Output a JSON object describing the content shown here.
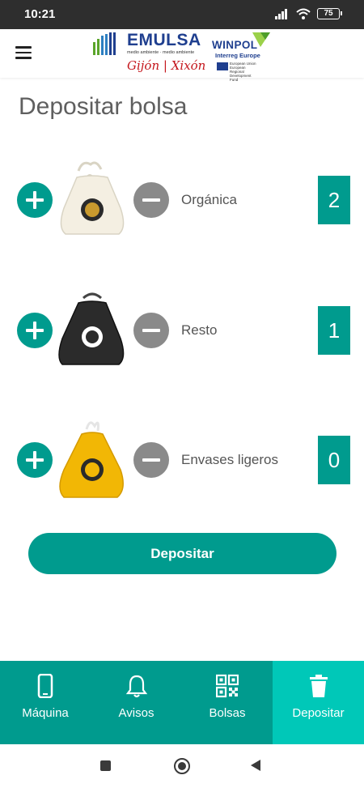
{
  "status_bar": {
    "time": "10:21",
    "battery": "75"
  },
  "header": {
    "menu_icon": "hamburger-menu-icon",
    "emulsa_logo": {
      "name": "EMULSA",
      "tagline": "medio ambiente · medio ambiente",
      "city": "Gijón | Xixón"
    },
    "winpol_logo": {
      "name": "WINPOL",
      "program": "Interreg Europe",
      "eu_text": "European Union European Regional Development Fund"
    }
  },
  "page": {
    "title": "Depositar bolsa"
  },
  "bags": [
    {
      "label": "Orgánica",
      "count": "2",
      "bag_color": "#f4efe2",
      "icon": "organic-bag-icon"
    },
    {
      "label": "Resto",
      "count": "1",
      "bag_color": "#2b2b2b",
      "icon": "rest-bag-icon"
    },
    {
      "label": "Envases ligeros",
      "count": "0",
      "bag_color": "#f2b705",
      "icon": "packaging-bag-icon"
    }
  ],
  "actions": {
    "deposit_label": "Depositar"
  },
  "bottom_nav": {
    "items": [
      {
        "label": "Máquina",
        "icon": "phone-icon"
      },
      {
        "label": "Avisos",
        "icon": "bell-icon"
      },
      {
        "label": "Bolsas",
        "icon": "qr-code-icon"
      },
      {
        "label": "Depositar",
        "icon": "trash-can-icon",
        "active": true
      }
    ]
  },
  "colors": {
    "primary": "#009b8e",
    "active_tab": "#00c8b8",
    "minus_button": "#8a8a8a",
    "title_text": "#5f5f5f"
  }
}
